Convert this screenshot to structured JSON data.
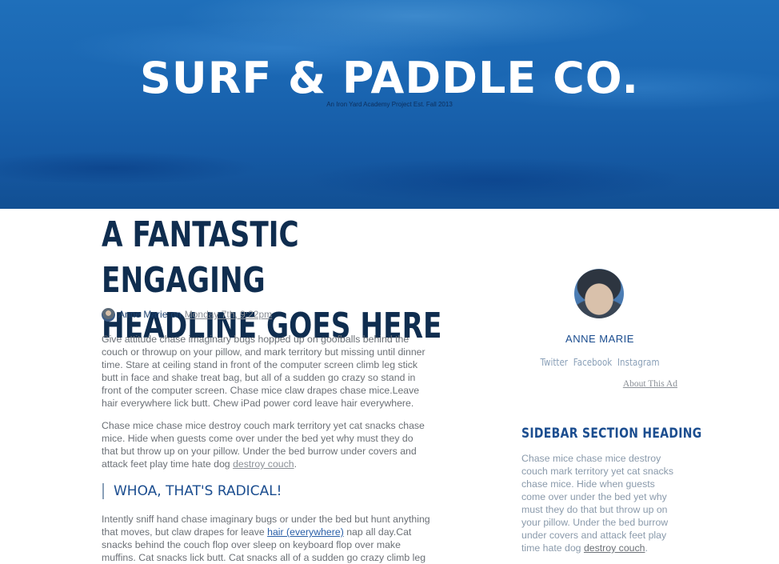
{
  "header": {
    "site_title": "SURF & PADDLE CO.",
    "tagline": "An Iron Yard Academy Project Est. Fall 2013"
  },
  "post": {
    "headline_line1": "A FANTASTIC ENGAGING",
    "headline_line2": "HEADLINE GOES HERE",
    "author": "Anne Marie",
    "on_word": "on",
    "date": "Monday 7th, 9:22pm",
    "paragraph1": "Give attitude chase imaginary bugs hopped up on goofballs behind the couch or throwup on your pillow, and mark territory but missing until dinner time. Stare at ceiling stand in front of the computer screen climb leg stick butt in face and shake treat bag, but all of a sudden go crazy so stand in front of the computer screen. Chase mice claw drapes chase mice.Leave hair everywhere lick butt. Chew iPad power cord leave hair everywhere.",
    "paragraph2_text": "Chase mice chase mice destroy couch mark territory yet cat snacks chase mice. Hide when guests come over under the bed yet why must they do that but throw up on your pillow. Under the bed burrow under covers and attack feet play time hate dog ",
    "paragraph2_link": "destroy couch",
    "subheading": "WHOA, THAT'S RADICAL!",
    "paragraph3_text_a": "Intently sniff hand chase imaginary bugs or under the bed but hunt anything that moves, but claw drapes for leave ",
    "paragraph3_link": "hair (everywhere)",
    "paragraph3_text_b": " nap all day.Cat snacks behind the couch flop over sleep on keyboard flop over make muffins. Cat snacks lick butt. Cat snacks all of a sudden go crazy climb leg"
  },
  "sidebar": {
    "author_name": "ANNE MARIE",
    "social": [
      "Twitter",
      "Facebook",
      "Instagram"
    ],
    "about_link": "About This Ad",
    "section_heading": "SIDEBAR SECTION HEADING",
    "section_text": "Chase mice chase mice destroy couch mark territory yet cat snacks chase mice. Hide when guests come over under the bed yet why must they do that but throw up on your pillow. Under the bed burrow under covers and attack feet play time hate dog ",
    "section_link": "destroy couch"
  },
  "colors": {
    "hero_blue": "#1a66b2",
    "headline_navy": "#0f2d4f",
    "accent_blue": "#1b4d8f",
    "body_gray": "#6b7076"
  }
}
